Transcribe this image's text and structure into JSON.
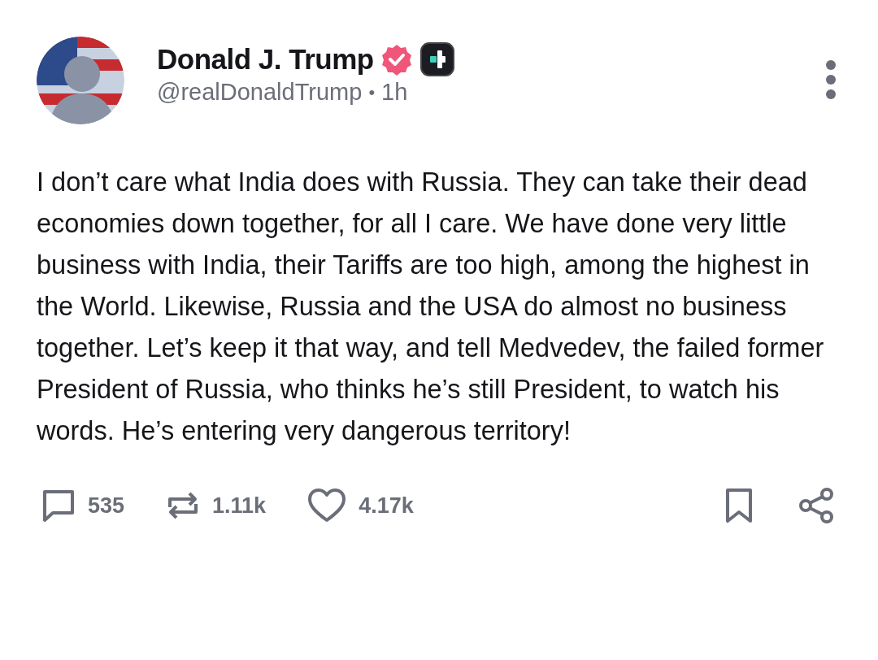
{
  "post": {
    "author": {
      "name": "Donald J. Trump",
      "badges": [
        {
          "kind": "verified"
        },
        {
          "kind": "plus"
        }
      ],
      "handle": "@realDonaldTrump",
      "separator": "•",
      "time": "1h"
    },
    "text": "I don’t care what India does with Russia. They can take their dead economies down together, for all I care. We have done very little business with India, their Tariffs are too high, among the highest in the World. Likewise, Russia and the USA do almost no business together. Let’s keep it that way, and tell Medvedev, the failed former President of Russia, who thinks he’s still President, to watch his words. He’s entering very dangerous territory!",
    "actions": [
      {
        "kind": "reply",
        "count": "535"
      },
      {
        "kind": "repost",
        "count": "1.11k"
      },
      {
        "kind": "like",
        "count": "4.17k"
      },
      {
        "kind": "bookmark"
      },
      {
        "kind": "share"
      }
    ]
  }
}
